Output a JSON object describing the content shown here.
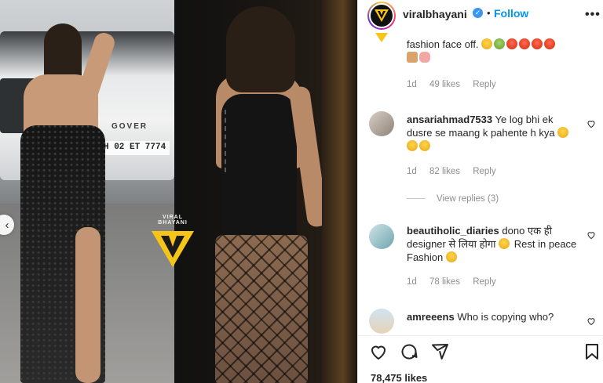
{
  "post": {
    "watermark_text": "VIRAL BHAYANI",
    "car_plate": "H 02 ET 7774",
    "car_brand": "GOVER"
  },
  "header": {
    "username": "viralbhayani",
    "verified_icon": "verified-badge-icon",
    "separator": "•",
    "follow_label": "Follow",
    "more_icon": "•••"
  },
  "comments": [
    {
      "text": "fashion face off.",
      "emoji_line1": [
        "yellow",
        "green",
        "red",
        "red",
        "red",
        "red"
      ],
      "emoji_line2": [
        "animal",
        "pig"
      ],
      "time": "1d",
      "likes": "49 likes",
      "reply": "Reply"
    },
    {
      "username": "ansariahmad7533",
      "text": "Ye log bhi ek dusre se maang k pahente h kya",
      "time": "1d",
      "likes": "82 likes",
      "reply": "Reply",
      "view_replies": "View replies (3)"
    },
    {
      "username": "beautiholic_diaries",
      "text": "dono एक ही designer से लिया होगा",
      "text2": "Rest in peace Fashion",
      "time": "1d",
      "likes": "78 likes",
      "reply": "Reply"
    },
    {
      "username": "amreeens",
      "text": "Who is copying who?"
    }
  ],
  "actions": {
    "like_icon": "heart-icon",
    "comment_icon": "comment-icon",
    "share_icon": "send-icon",
    "save_icon": "bookmark-icon"
  },
  "likes_count": "78,475 likes",
  "colors": {
    "follow": "#0095f6",
    "verified": "#3897f0",
    "meta": "#8e8e8e",
    "watermark_yellow": "#f5c518"
  }
}
